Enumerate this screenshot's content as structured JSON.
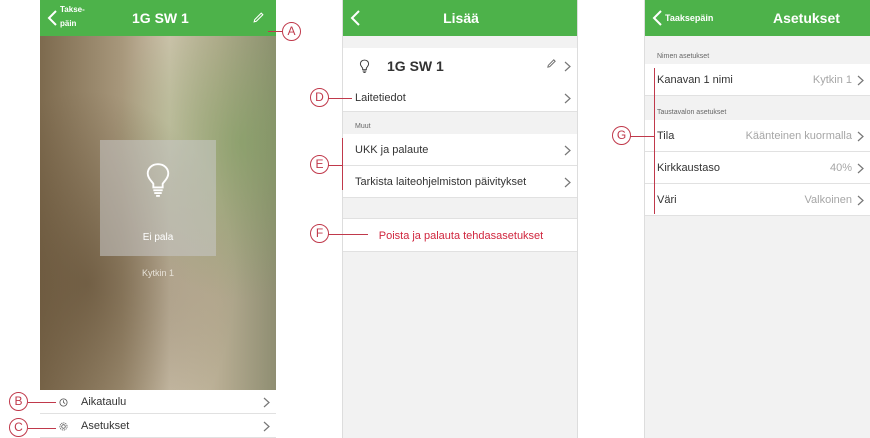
{
  "screen1": {
    "back_label": "Takse-\npäin",
    "title": "1G SW 1",
    "tile_status": "Ei pala",
    "channel_label": "Kytkin 1",
    "menu": [
      {
        "label": "Aikataulu",
        "icon": "clock-icon"
      },
      {
        "label": "Asetukset",
        "icon": "gear-icon"
      }
    ]
  },
  "screen2": {
    "title": "Lisää",
    "device_name": "1G SW 1",
    "device_info": "Laitetiedot",
    "section_other": "Muut",
    "faq": "UKK ja palaute",
    "firmware": "Tarkista laiteohjelmiston päivitykset",
    "reset": "Poista ja palauta tehdasasetukset"
  },
  "screen3": {
    "back_label": "Taaksepäin",
    "title": "Asetukset",
    "section_name": "Nimen asetukset",
    "channel_name_label": "Kanavan 1 nimi",
    "channel_name_value": "Kytkin 1",
    "section_backlight": "Taustavalon asetukset",
    "mode_label": "Tila",
    "mode_value": "Käänteinen kuormalla",
    "brightness_label": "Kirkkaustaso",
    "brightness_value": "40%",
    "color_label": "Väri",
    "color_value": "Valkoinen"
  },
  "callouts": {
    "a": "A",
    "b": "B",
    "c": "C",
    "d": "D",
    "e": "E",
    "f": "F",
    "g": "G"
  },
  "colors": {
    "header_green": "#4db24a",
    "callout_red": "#c0394b",
    "reset_red": "#d0263e"
  }
}
